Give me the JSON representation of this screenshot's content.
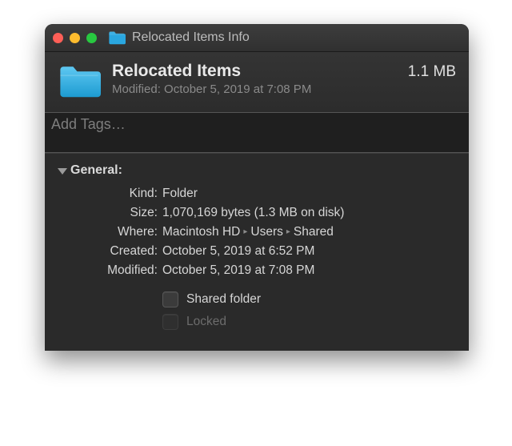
{
  "window": {
    "title": "Relocated Items Info"
  },
  "header": {
    "name": "Relocated Items",
    "size": "1.1 MB",
    "modified_line": "Modified: October 5, 2019 at 7:08 PM"
  },
  "tags": {
    "placeholder": "Add Tags…"
  },
  "general": {
    "title": "General:",
    "kind_label": "Kind:",
    "kind_value": "Folder",
    "size_label": "Size:",
    "size_value": "1,070,169 bytes (1.3 MB on disk)",
    "where_label": "Where:",
    "where_parts": [
      "Macintosh HD",
      "Users",
      "Shared"
    ],
    "created_label": "Created:",
    "created_value": "October 5, 2019 at 6:52 PM",
    "modified_label": "Modified:",
    "modified_value": "October 5, 2019 at 7:08 PM",
    "shared_label": "Shared folder",
    "locked_label": "Locked"
  }
}
